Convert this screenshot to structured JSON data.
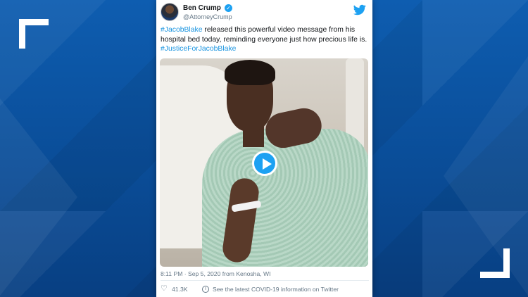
{
  "tweet": {
    "author_name": "Ben Crump",
    "author_handle": "@AttorneyCrump",
    "text_parts": [
      {
        "text": "#JacobBlake",
        "type": "hashtag"
      },
      {
        "text": " released this powerful video message from his hospital bed today, reminding everyone just how precious life is. ",
        "type": "text"
      },
      {
        "text": "#JusticeForJacobBlake",
        "type": "hashtag"
      }
    ],
    "timestamp": "8:11 PM · Sep 5, 2020 from Kenosha, WI",
    "likes": "41.3K",
    "covid_link": "See the latest COVID-19 information on Twitter"
  },
  "colors": {
    "background_blue": "#0b4f9c",
    "twitter_blue": "#1da1f2",
    "hashtag": "#1b95e0",
    "muted_text": "#657786"
  },
  "icons": [
    "verified-badge-icon",
    "twitter-bird-icon",
    "play-icon",
    "heart-icon",
    "info-icon"
  ]
}
